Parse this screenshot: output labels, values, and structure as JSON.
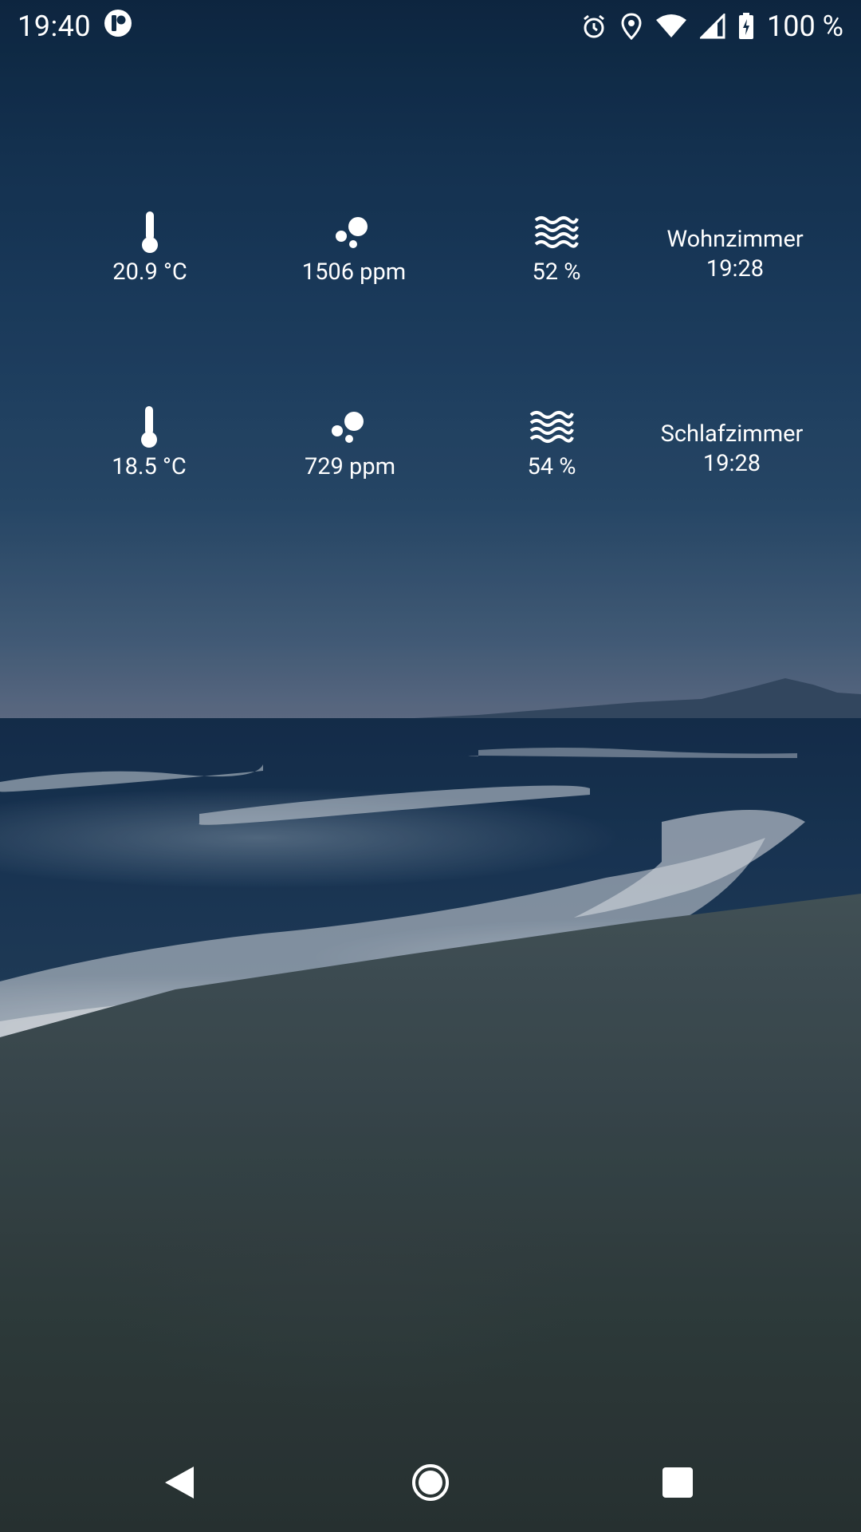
{
  "status_bar": {
    "time": "19:40",
    "battery": "100 %",
    "icons": [
      "app-notification-icon",
      "alarm-icon",
      "location-icon",
      "wifi-icon",
      "signal-icon",
      "battery-charging-icon"
    ]
  },
  "widget": {
    "rows": [
      {
        "room": "Wohnzimmer",
        "updated": "19:28",
        "temperature": "20.9 °C",
        "co2": "1506 ppm",
        "humidity": "52 %"
      },
      {
        "room": "Schlafzimmer",
        "updated": "19:28",
        "temperature": "18.5 °C",
        "co2": "729 ppm",
        "humidity": "54 %"
      }
    ],
    "icons": {
      "temperature": "thermometer-icon",
      "co2": "bubbles-icon",
      "humidity": "waves-icon"
    }
  },
  "nav_bar": {
    "buttons": [
      "back-icon",
      "home-icon",
      "recents-icon"
    ]
  },
  "colors": {
    "text": "#ffffff",
    "sky_top": "#0f2a45",
    "sand": "#3f4e52"
  }
}
